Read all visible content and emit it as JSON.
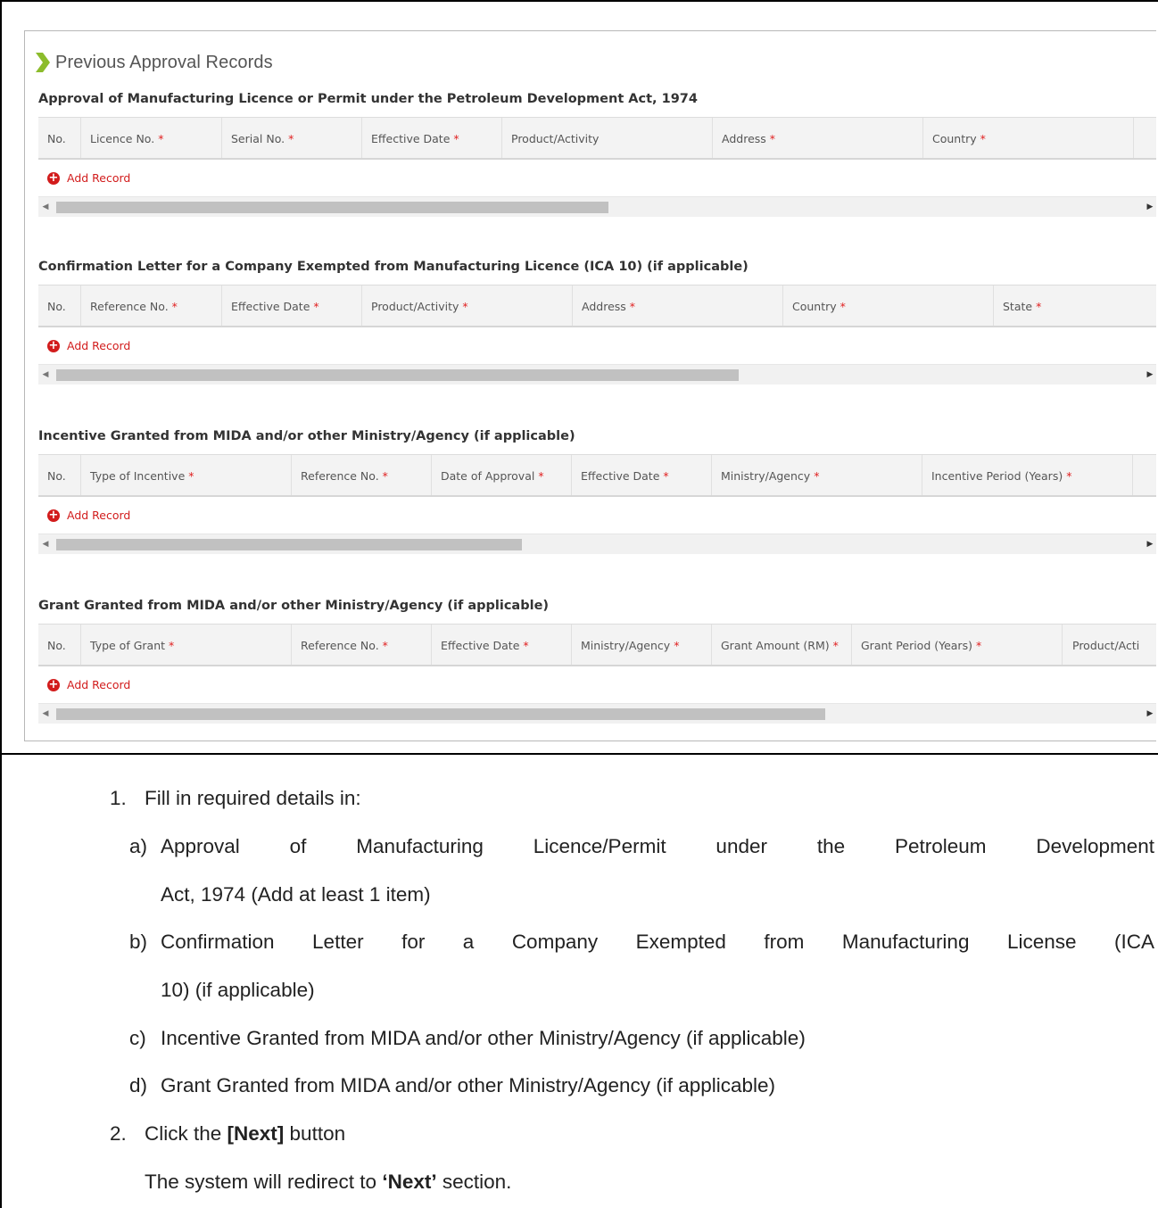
{
  "screenshot": {
    "heading": "Previous Approval Records",
    "add_label": "Add Record",
    "required_mark": "*",
    "sections": [
      {
        "title": "Approval of Manufacturing Licence or Permit under the Petroleum Development Act, 1974",
        "columns": [
          {
            "label": "No.",
            "required": false
          },
          {
            "label": "Licence No.",
            "required": true
          },
          {
            "label": "Serial No.",
            "required": true
          },
          {
            "label": "Effective Date",
            "required": true
          },
          {
            "label": "Product/Activity",
            "required": false
          },
          {
            "label": "Address",
            "required": true
          },
          {
            "label": "Country",
            "required": true
          }
        ],
        "scroll_fraction": 0.51
      },
      {
        "title": "Confirmation Letter for a Company Exempted from Manufacturing Licence (ICA 10) (if applicable)",
        "columns": [
          {
            "label": "No.",
            "required": false
          },
          {
            "label": "Reference No.",
            "required": true
          },
          {
            "label": "Effective Date",
            "required": true
          },
          {
            "label": "Product/Activity",
            "required": true
          },
          {
            "label": "Address",
            "required": true
          },
          {
            "label": "Country",
            "required": true
          },
          {
            "label": "State",
            "required": true
          }
        ],
        "scroll_fraction": 0.63
      },
      {
        "title": "Incentive Granted from MIDA and/or other Ministry/Agency (if applicable)",
        "columns": [
          {
            "label": "No.",
            "required": false
          },
          {
            "label": "Type of Incentive",
            "required": true
          },
          {
            "label": "Reference No.",
            "required": true
          },
          {
            "label": "Date of Approval",
            "required": true
          },
          {
            "label": "Effective Date",
            "required": true
          },
          {
            "label": "Ministry/Agency",
            "required": true
          },
          {
            "label": "Incentive Period (Years)",
            "required": true
          }
        ],
        "scroll_fraction": 0.43
      },
      {
        "title": "Grant Granted from MIDA and/or other Ministry/Agency (if applicable)",
        "columns": [
          {
            "label": "No.",
            "required": false
          },
          {
            "label": "Type of Grant",
            "required": true
          },
          {
            "label": "Reference No.",
            "required": true
          },
          {
            "label": "Effective Date",
            "required": true
          },
          {
            "label": "Ministry/Agency",
            "required": true
          },
          {
            "label": "Grant Amount (RM)",
            "required": true
          },
          {
            "label": "Grant Period (Years) ",
            "required": true
          },
          {
            "label": "Product/Acti",
            "required": false
          }
        ],
        "scroll_fraction": 0.71
      }
    ]
  },
  "instructions": {
    "step1_num": "1.",
    "step1_text": "Fill in required details in:",
    "items": [
      {
        "letter": "a)",
        "line1": "Approval of Manufacturing Licence/Permit under the Petroleum Development",
        "line2": "Act, 1974 (Add at least 1 item)"
      },
      {
        "letter": "b)",
        "line1": "Confirmation Letter for a Company Exempted from Manufacturing License (ICA",
        "line2": "10) (if applicable)"
      },
      {
        "letter": "c)",
        "line1": "Incentive Granted from MIDA and/or other Ministry/Agency (if applicable)",
        "line2": ""
      },
      {
        "letter": "d)",
        "line1": "Grant Granted from MIDA and/or other Ministry/Agency (if applicable)",
        "line2": ""
      }
    ],
    "step2_num": "2.",
    "step2_pre": "Click the ",
    "step2_bold": "[Next]",
    "step2_post": " button",
    "step2_note_pre": "The system will redirect to ",
    "step2_note_bold": "‘Next’",
    "step2_note_post": " section."
  }
}
